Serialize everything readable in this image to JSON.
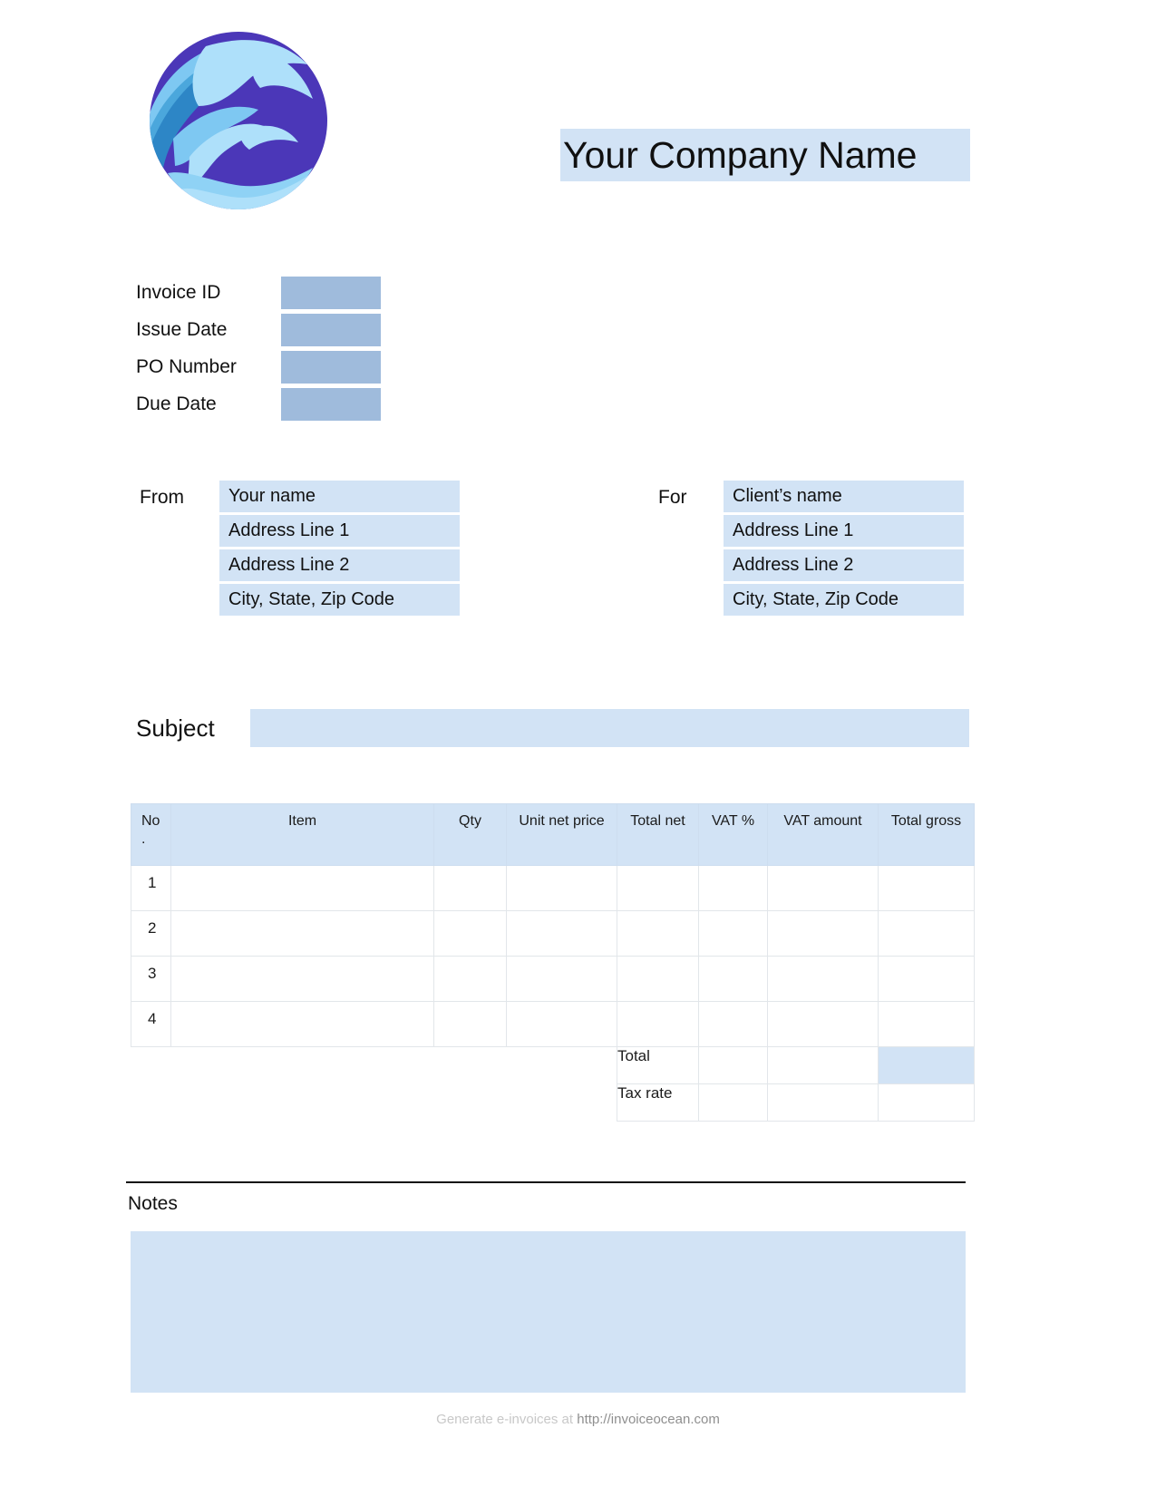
{
  "header": {
    "logo_icon": "ocean-wave-globe-logo",
    "company_name": "Your Company Name"
  },
  "meta": {
    "rows": [
      {
        "label": "Invoice ID",
        "value": ""
      },
      {
        "label": "Issue Date",
        "value": ""
      },
      {
        "label": "PO Number",
        "value": ""
      },
      {
        "label": "Due Date",
        "value": ""
      }
    ]
  },
  "parties": {
    "from": {
      "label": "From",
      "fields": [
        "Your name",
        "Address Line 1",
        "Address Line 2",
        "City, State, Zip Code"
      ]
    },
    "for": {
      "label": "For",
      "fields": [
        "Client’s name",
        "Address Line 1",
        "Address Line 2",
        "City, State, Zip Code"
      ]
    }
  },
  "subject": {
    "label": "Subject",
    "value": ""
  },
  "items": {
    "columns": [
      "No\n.",
      "Item",
      "Qty",
      "Unit net price",
      "Total net",
      "VAT %",
      "VAT amount",
      "Total gross"
    ],
    "column_no": "No",
    "column_no_suffix": ".",
    "column_item": "Item",
    "column_qty": "Qty",
    "column_unit_net_price": "Unit net price",
    "column_total_net": "Total net",
    "column_vat_percent": "VAT %",
    "column_vat_amount": "VAT amount",
    "column_total_gross": "Total gross",
    "rows": [
      {
        "no": "1",
        "item": "",
        "qty": "",
        "unit_net_price": "",
        "total_net": "",
        "vat_percent": "",
        "vat_amount": "",
        "total_gross": ""
      },
      {
        "no": "2",
        "item": "",
        "qty": "",
        "unit_net_price": "",
        "total_net": "",
        "vat_percent": "",
        "vat_amount": "",
        "total_gross": ""
      },
      {
        "no": "3",
        "item": "",
        "qty": "",
        "unit_net_price": "",
        "total_net": "",
        "vat_percent": "",
        "vat_amount": "",
        "total_gross": ""
      },
      {
        "no": "4",
        "item": "",
        "qty": "",
        "unit_net_price": "",
        "total_net": "",
        "vat_percent": "",
        "vat_amount": "",
        "total_gross": ""
      }
    ],
    "summary": [
      {
        "label": "Total",
        "vat_percent": "",
        "vat_amount": "",
        "total_gross": ""
      },
      {
        "label": "Tax rate",
        "vat_percent": "",
        "vat_amount": "",
        "total_gross": ""
      }
    ],
    "summary_total_label": "Total",
    "summary_tax_rate_label": "Tax rate"
  },
  "notes": {
    "label": "Notes",
    "value": ""
  },
  "footer": {
    "text": "Generate e-invoices at",
    "url": "http://invoiceocean.com"
  },
  "colors": {
    "field_light": "#d2e3f5",
    "field_dark": "#9fbbdc",
    "table_border": "#e2e6ea",
    "logo_purple": "#4b37b8",
    "logo_blue_mid": "#2d86c6",
    "logo_blue_light": "#7ec8f2",
    "logo_blue_pale": "#aee0fa"
  }
}
